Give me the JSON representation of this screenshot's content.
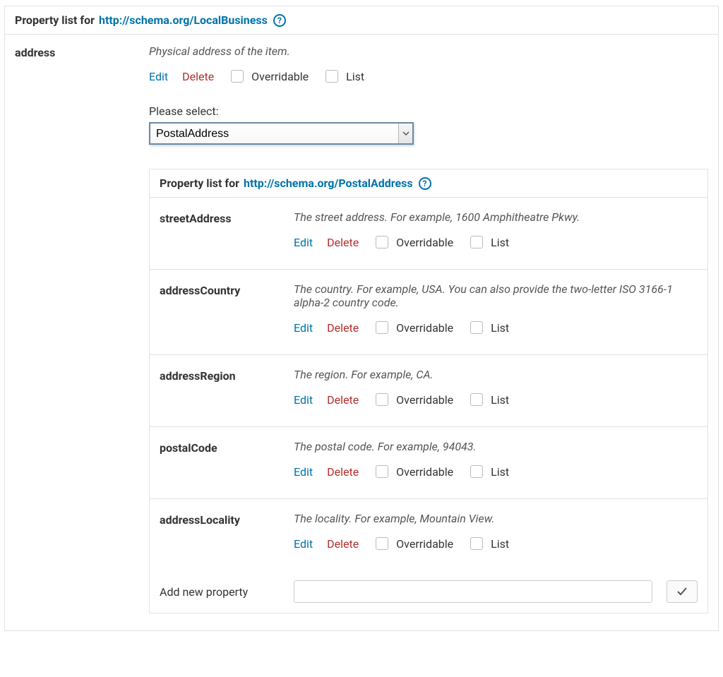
{
  "outerPanel": {
    "title_prefix": "Property list for ",
    "title_link": "http://schema.org/LocalBusiness"
  },
  "labels": {
    "edit": "Edit",
    "delete": "Delete",
    "overridable": "Overridable",
    "list": "List",
    "pleaseSelect": "Please select:",
    "addNewProperty": "Add new property"
  },
  "address": {
    "name": "address",
    "desc": "Physical address of the item.",
    "selectValue": "PostalAddress"
  },
  "nestedPanel": {
    "title_prefix": "Property list for ",
    "title_link": "http://schema.org/PostalAddress"
  },
  "nestedProps": [
    {
      "name": "streetAddress",
      "desc": "The street address. For example, 1600 Amphitheatre Pkwy."
    },
    {
      "name": "addressCountry",
      "desc": "The country. For example, USA. You can also provide the two-letter ISO 3166-1 alpha-2 country code."
    },
    {
      "name": "addressRegion",
      "desc": "The region. For example, CA."
    },
    {
      "name": "postalCode",
      "desc": "The postal code. For example, 94043."
    },
    {
      "name": "addressLocality",
      "desc": "The locality. For example, Mountain View."
    }
  ]
}
